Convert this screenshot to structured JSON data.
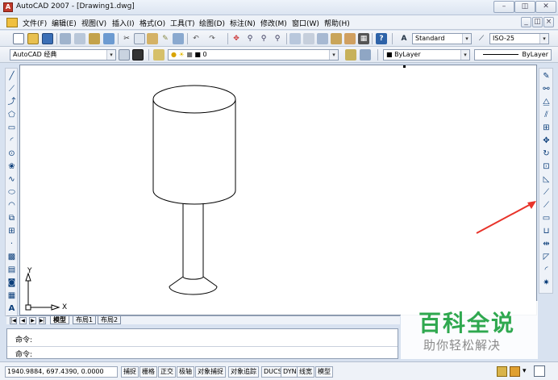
{
  "title_bar": {
    "app_letter": "A",
    "title": "AutoCAD 2007 - [Drawing1.dwg]",
    "buttons": {
      "minimize": "–",
      "restore": "◫",
      "close": "✕"
    }
  },
  "menu": {
    "items": [
      "文件(F)",
      "编辑(E)",
      "视图(V)",
      "插入(I)",
      "格式(O)",
      "工具(T)",
      "绘图(D)",
      "标注(N)",
      "修改(M)",
      "窗口(W)",
      "帮助(H)"
    ],
    "doc_buttons": {
      "minimize": "_",
      "restore": "◫",
      "close": "×"
    }
  },
  "standard_toolbar": {
    "text_style": "Standard",
    "dim_style": "ISO-25"
  },
  "workspace_toolbar": {
    "workspace": "AutoCAD 经典",
    "layer": "0",
    "color": "ByLayer",
    "linetype": "ByLayer",
    "lineweight": "ByLayer"
  },
  "layout_tabs": {
    "nav": [
      "|◀",
      "◀",
      "▶",
      "▶|"
    ],
    "tabs": [
      "模型",
      "布局1",
      "布局2"
    ]
  },
  "ucs": {
    "x_label": "X",
    "y_label": "Y"
  },
  "command": {
    "line1": "命令:",
    "line2": "命令:"
  },
  "status_bar": {
    "coords": "1940.9884, 697.4390, 0.0000",
    "buttons": [
      "捕捉",
      "栅格",
      "正交",
      "极轴",
      "对象捕捉",
      "对象追踪",
      "DUCS",
      "DYN",
      "线宽",
      "模型"
    ]
  },
  "watermark": {
    "main": "百科全说",
    "sub": "助你轻松解决"
  },
  "colors": {
    "annotation_arrow": "#e8332a",
    "watermark_green": "#2fa84f"
  }
}
